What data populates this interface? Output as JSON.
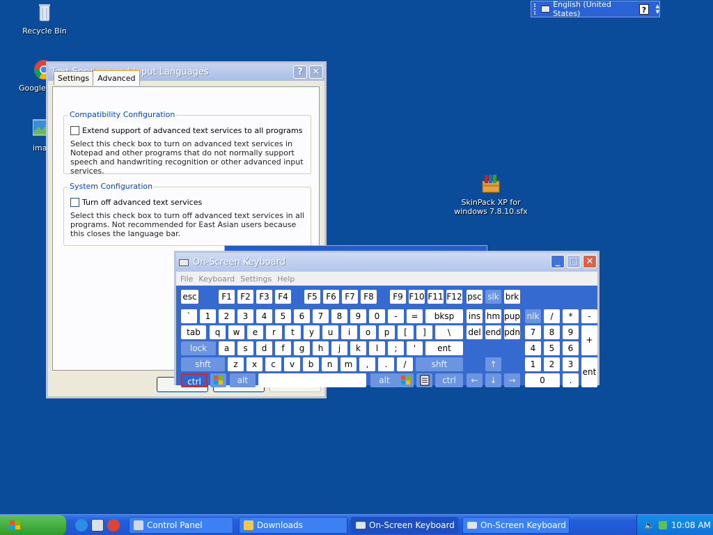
{
  "desktop": {
    "icons": [
      {
        "label": "Recycle Bin"
      },
      {
        "label": "Google C"
      },
      {
        "label": "imag"
      },
      {
        "label": "SkinPack XP for windows 7.8.10.sfx"
      }
    ]
  },
  "langbar": {
    "language": "English (United States)",
    "help": "?"
  },
  "ts_dialog": {
    "title": "Text Services and Input Languages",
    "tabs": [
      "Settings",
      "Advanced"
    ],
    "compat": {
      "title": "Compatibility Configuration",
      "checkbox": "Extend support of advanced text services to all programs",
      "desc": "Select this check box to turn on advanced text services in Notepad and other programs that do not normally support speech and handwriting recognition or other advanced input services."
    },
    "system": {
      "title": "System Configuration",
      "checkbox": "Turn off advanced text services",
      "desc": "Select this check box to turn off advanced text services in all programs. Not recommended for East Asian users because this closes the language bar."
    }
  },
  "osk": {
    "title": "On-Screen Keyboard",
    "menu": [
      "File",
      "Keyboard",
      "Settings",
      "Help"
    ],
    "keys": {
      "esc": "esc",
      "f1": "F1",
      "f2": "F2",
      "f3": "F3",
      "f4": "F4",
      "f5": "F5",
      "f6": "F6",
      "f7": "F7",
      "f8": "F8",
      "f9": "F9",
      "f10": "F10",
      "f11": "F11",
      "f12": "F12",
      "psc": "psc",
      "slk": "slk",
      "brk": "brk",
      "grave": "`",
      "n1": "1",
      "n2": "2",
      "n3": "3",
      "n4": "4",
      "n5": "5",
      "n6": "6",
      "n7": "7",
      "n8": "8",
      "n9": "9",
      "n0": "0",
      "minus": "-",
      "equals": "=",
      "bksp": "bksp",
      "ins": "ins",
      "hm": "hm",
      "pup": "pup",
      "nlk": "nlk",
      "np_div": "/",
      "np_mul": "*",
      "np_sub": "-",
      "tab": "tab",
      "q": "q",
      "w": "w",
      "e": "e",
      "r": "r",
      "t": "t",
      "y": "y",
      "u": "u",
      "i": "i",
      "o": "o",
      "p": "p",
      "lbr": "[",
      "rbr": "]",
      "bslash": "\\",
      "del": "del",
      "end": "end",
      "pdn": "pdn",
      "np7": "7",
      "np8": "8",
      "np9": "9",
      "np_add": "+",
      "lock": "lock",
      "a": "a",
      "s": "s",
      "d": "d",
      "f": "f",
      "g": "g",
      "h": "h",
      "j": "j",
      "k": "k",
      "l": "l",
      "semi": ";",
      "quote": "'",
      "ent": "ent",
      "np4": "4",
      "np5": "5",
      "np6": "6",
      "shft": "shft",
      "z": "z",
      "x": "x",
      "c": "c",
      "v": "v",
      "b": "b",
      "n": "n",
      "m": "m",
      "comma": ",",
      "period": ".",
      "slash": "/",
      "shft_r": "shft",
      "up": "↑",
      "np1": "1",
      "np2": "2",
      "np3": "3",
      "np_ent": "ent",
      "ctrl": "ctrl",
      "alt": "alt",
      "alt_r": "alt",
      "ctrl_r": "ctrl",
      "left": "←",
      "down": "↓",
      "right": "→",
      "np0": "0",
      "np_dot": "."
    }
  },
  "taskbar": {
    "tasks": [
      "Control Panel",
      "Downloads",
      "On-Screen Keyboard",
      "On-Screen Keyboard"
    ],
    "clock": "10:08 AM"
  },
  "colors": {
    "desktop": "#0a4c99",
    "keyboard_bg": "#356bd0",
    "active_border": "#dd2222"
  }
}
